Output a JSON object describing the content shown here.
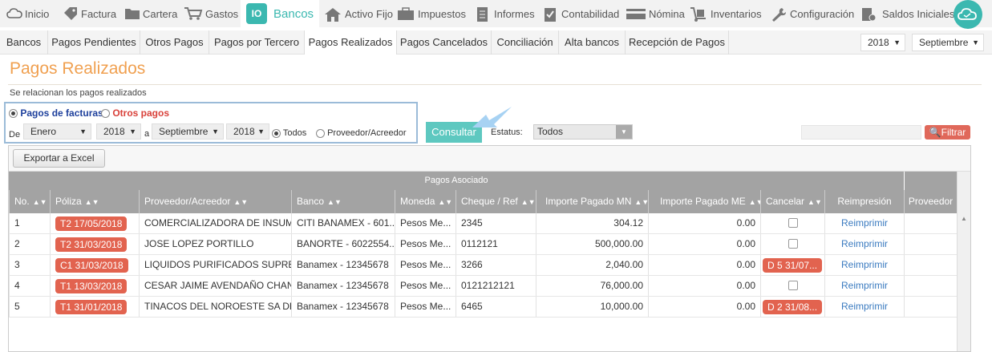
{
  "topnav": [
    {
      "label": "Inicio",
      "icon": "cloud-icon"
    },
    {
      "label": "Factura",
      "icon": "tag-icon"
    },
    {
      "label": "Cartera",
      "icon": "folder-icon"
    },
    {
      "label": "Gastos",
      "icon": "cart-icon"
    },
    {
      "label": "Bancos",
      "icon": "bank-icon",
      "icon_text": "IO"
    },
    {
      "label": "Activo Fijo",
      "icon": "house-icon"
    },
    {
      "label": "Impuestos",
      "icon": "briefcase-icon"
    },
    {
      "label": "Informes",
      "icon": "document-icon"
    },
    {
      "label": "Contabilidad",
      "icon": "clipboard-icon"
    },
    {
      "label": "Nómina",
      "icon": "card-icon"
    },
    {
      "label": "Inventarios",
      "icon": "dolly-icon"
    },
    {
      "label": "Configuración",
      "icon": "wrench-icon"
    },
    {
      "label": "Saldos Iniciales",
      "icon": "balance-icon"
    }
  ],
  "subnav": [
    "Bancos",
    "Pagos Pendientes",
    "Otros Pagos",
    "Pagos por Tercero",
    "Pagos Realizados",
    "Pagos Cancelados",
    "Conciliación",
    "Alta bancos",
    "Recepción de Pagos"
  ],
  "year_select": "2018",
  "month_select": "Septiembre",
  "page": {
    "title": "Pagos Realizados",
    "subtitle": "Se relacionan los pagos realizados"
  },
  "filters": {
    "radio_facturas": "Pagos de facturas",
    "radio_otros": "Otros pagos",
    "de_label": "De",
    "from_month": "Enero",
    "from_year": "2018",
    "a_label": "a",
    "to_month": "Septiembre",
    "to_year": "2018",
    "radio_todos": "Todos",
    "radio_proveedor": "Proveedor/Acreedor",
    "consultar": "Consultar",
    "estatus_label": "Estatus:",
    "estatus_value": "Todos",
    "filtrar": "Filtrar"
  },
  "grid": {
    "export": "Exportar a Excel",
    "group_header": "Pagos Asociado",
    "columns": [
      "No.",
      "Póliza",
      "Proveedor/Acreedor",
      "Banco",
      "Moneda",
      "Cheque / Ref",
      "Importe Pagado MN",
      "Importe Pagado ME",
      "Cancelar",
      "Reimpresión",
      "Proveedor"
    ],
    "reprint_label": "Reimprimir",
    "rows": [
      {
        "no": "1",
        "poliza": "T2 17/05/2018",
        "proveedor": "COMERCIALIZADORA DE INSUM...",
        "banco": "CITI BANAMEX - 601...",
        "moneda": "Pesos Me...",
        "ref": "2345",
        "mn": "304.12",
        "me": "0.00",
        "cancelar": ""
      },
      {
        "no": "2",
        "poliza": "T2 31/03/2018",
        "proveedor": "JOSE LOPEZ PORTILLO",
        "banco": "BANORTE - 6022554...",
        "moneda": "Pesos Me...",
        "ref": "0112121",
        "mn": "500,000.00",
        "me": "0.00",
        "cancelar": ""
      },
      {
        "no": "3",
        "poliza": "C1 31/03/2018",
        "proveedor": "LIQUIDOS PURIFICADOS SUPRE...",
        "banco": "Banamex - 12345678",
        "moneda": "Pesos Me...",
        "ref": "3266",
        "mn": "2,040.00",
        "me": "0.00",
        "cancelar": "D 5 31/07..."
      },
      {
        "no": "4",
        "poliza": "T1 13/03/2018",
        "proveedor": "CESAR JAIME AVENDAÑO CHAN",
        "banco": "Banamex - 12345678",
        "moneda": "Pesos Me...",
        "ref": "0121212121",
        "mn": "76,000.00",
        "me": "0.00",
        "cancelar": ""
      },
      {
        "no": "5",
        "poliza": "T1 31/01/2018",
        "proveedor": "TINACOS DEL NOROESTE SA DE ...",
        "banco": "Banamex - 12345678",
        "moneda": "Pesos Me...",
        "ref": "6465",
        "mn": "10,000.00",
        "me": "0.00",
        "cancelar": "D 2 31/08..."
      }
    ]
  }
}
